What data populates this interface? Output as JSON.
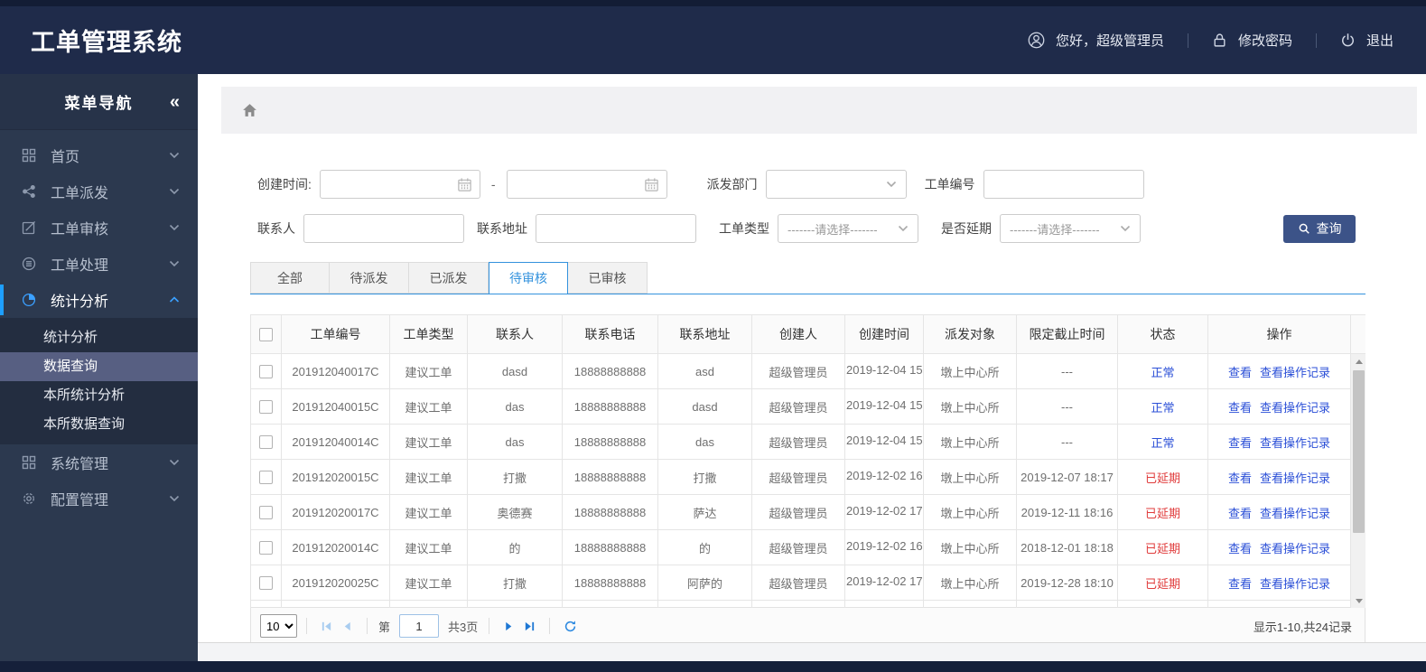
{
  "app": {
    "title": "工单管理系统"
  },
  "header": {
    "greeting": "您好，超级管理员",
    "change_password": "修改密码",
    "logout": "退出"
  },
  "sidebar": {
    "nav_title": "菜单导航",
    "collapse_glyph": "«",
    "items": [
      {
        "label": "首页",
        "icon": "grid"
      },
      {
        "label": "工单派发",
        "icon": "share"
      },
      {
        "label": "工单审核",
        "icon": "edit"
      },
      {
        "label": "工单处理",
        "icon": "process"
      },
      {
        "label": "统计分析",
        "icon": "pie",
        "active": true,
        "children": [
          "统计分析",
          "数据查询",
          "本所统计分析",
          "本所数据查询"
        ],
        "active_child": "数据查询"
      },
      {
        "label": "系统管理",
        "icon": "grid"
      },
      {
        "label": "配置管理",
        "icon": "gear"
      }
    ]
  },
  "filters": {
    "create_time_label": "创建时间:",
    "range_separator": "-",
    "dispatch_dept_label": "派发部门",
    "order_no_label": "工单编号",
    "contact_label": "联系人",
    "address_label": "联系地址",
    "order_type_label": "工单类型",
    "order_type_value": "-------请选择-------",
    "delay_label": "是否延期",
    "delay_value": "-------请选择-------",
    "search_button": "查询"
  },
  "tabs": [
    {
      "label": "全部",
      "active": false
    },
    {
      "label": "待派发",
      "active": false
    },
    {
      "label": "已派发",
      "active": false
    },
    {
      "label": "待审核",
      "active": true
    },
    {
      "label": "已审核",
      "active": false
    }
  ],
  "table": {
    "headers": [
      "工单编号",
      "工单类型",
      "联系人",
      "联系电话",
      "联系地址",
      "创建人",
      "创建时间",
      "派发对象",
      "限定截止时间",
      "状态",
      "操作"
    ],
    "action_labels": {
      "view": "查看",
      "view_log": "查看操作记录"
    },
    "partial_row_visible": true,
    "rows": [
      {
        "order_no": "201912040017C",
        "type": "建议工单",
        "contact": "dasd",
        "phone": "18888888888",
        "address": "asd",
        "creator": "超级管理员",
        "create_time": "2019-12-04 15",
        "target": "墩上中心所",
        "deadline": "---",
        "status": "正常",
        "status_type": "normal"
      },
      {
        "order_no": "201912040015C",
        "type": "建议工单",
        "contact": "das",
        "phone": "18888888888",
        "address": "dasd",
        "creator": "超级管理员",
        "create_time": "2019-12-04 15",
        "target": "墩上中心所",
        "deadline": "---",
        "status": "正常",
        "status_type": "normal"
      },
      {
        "order_no": "201912040014C",
        "type": "建议工单",
        "contact": "das",
        "phone": "18888888888",
        "address": "das",
        "creator": "超级管理员",
        "create_time": "2019-12-04 15",
        "target": "墩上中心所",
        "deadline": "---",
        "status": "正常",
        "status_type": "normal"
      },
      {
        "order_no": "201912020015C",
        "type": "建议工单",
        "contact": "打撒",
        "phone": "18888888888",
        "address": "打撒",
        "creator": "超级管理员",
        "create_time": "2019-12-02 16",
        "target": "墩上中心所",
        "deadline": "2019-12-07 18:17",
        "status": "已延期",
        "status_type": "delay"
      },
      {
        "order_no": "201912020017C",
        "type": "建议工单",
        "contact": "奥德赛",
        "phone": "18888888888",
        "address": "萨达",
        "creator": "超级管理员",
        "create_time": "2019-12-02 17",
        "target": "墩上中心所",
        "deadline": "2019-12-11 18:16",
        "status": "已延期",
        "status_type": "delay"
      },
      {
        "order_no": "201912020014C",
        "type": "建议工单",
        "contact": "的",
        "phone": "18888888888",
        "address": "的",
        "creator": "超级管理员",
        "create_time": "2019-12-02 16",
        "target": "墩上中心所",
        "deadline": "2018-12-01 18:18",
        "status": "已延期",
        "status_type": "delay"
      },
      {
        "order_no": "201912020025C",
        "type": "建议工单",
        "contact": "打撒",
        "phone": "18888888888",
        "address": "阿萨的",
        "creator": "超级管理员",
        "create_time": "2019-12-02 17",
        "target": "墩上中心所",
        "deadline": "2019-12-28 18:10",
        "status": "已延期",
        "status_type": "delay"
      }
    ]
  },
  "pagination": {
    "page_size": "10",
    "page_prefix": "第",
    "current_page": "1",
    "total_pages": "共3页",
    "summary": "显示1-10,共24记录"
  },
  "colors": {
    "header_bg": "#1f2b4a",
    "sidebar_bg": "#2c394f",
    "accent_blue": "#1e9fff",
    "tab_blue": "#3392dd",
    "link_blue": "#2b4fd7",
    "danger_red": "#e03b3b",
    "button_bg": "#3c5388",
    "active_subitem_bg": "#575f82"
  }
}
